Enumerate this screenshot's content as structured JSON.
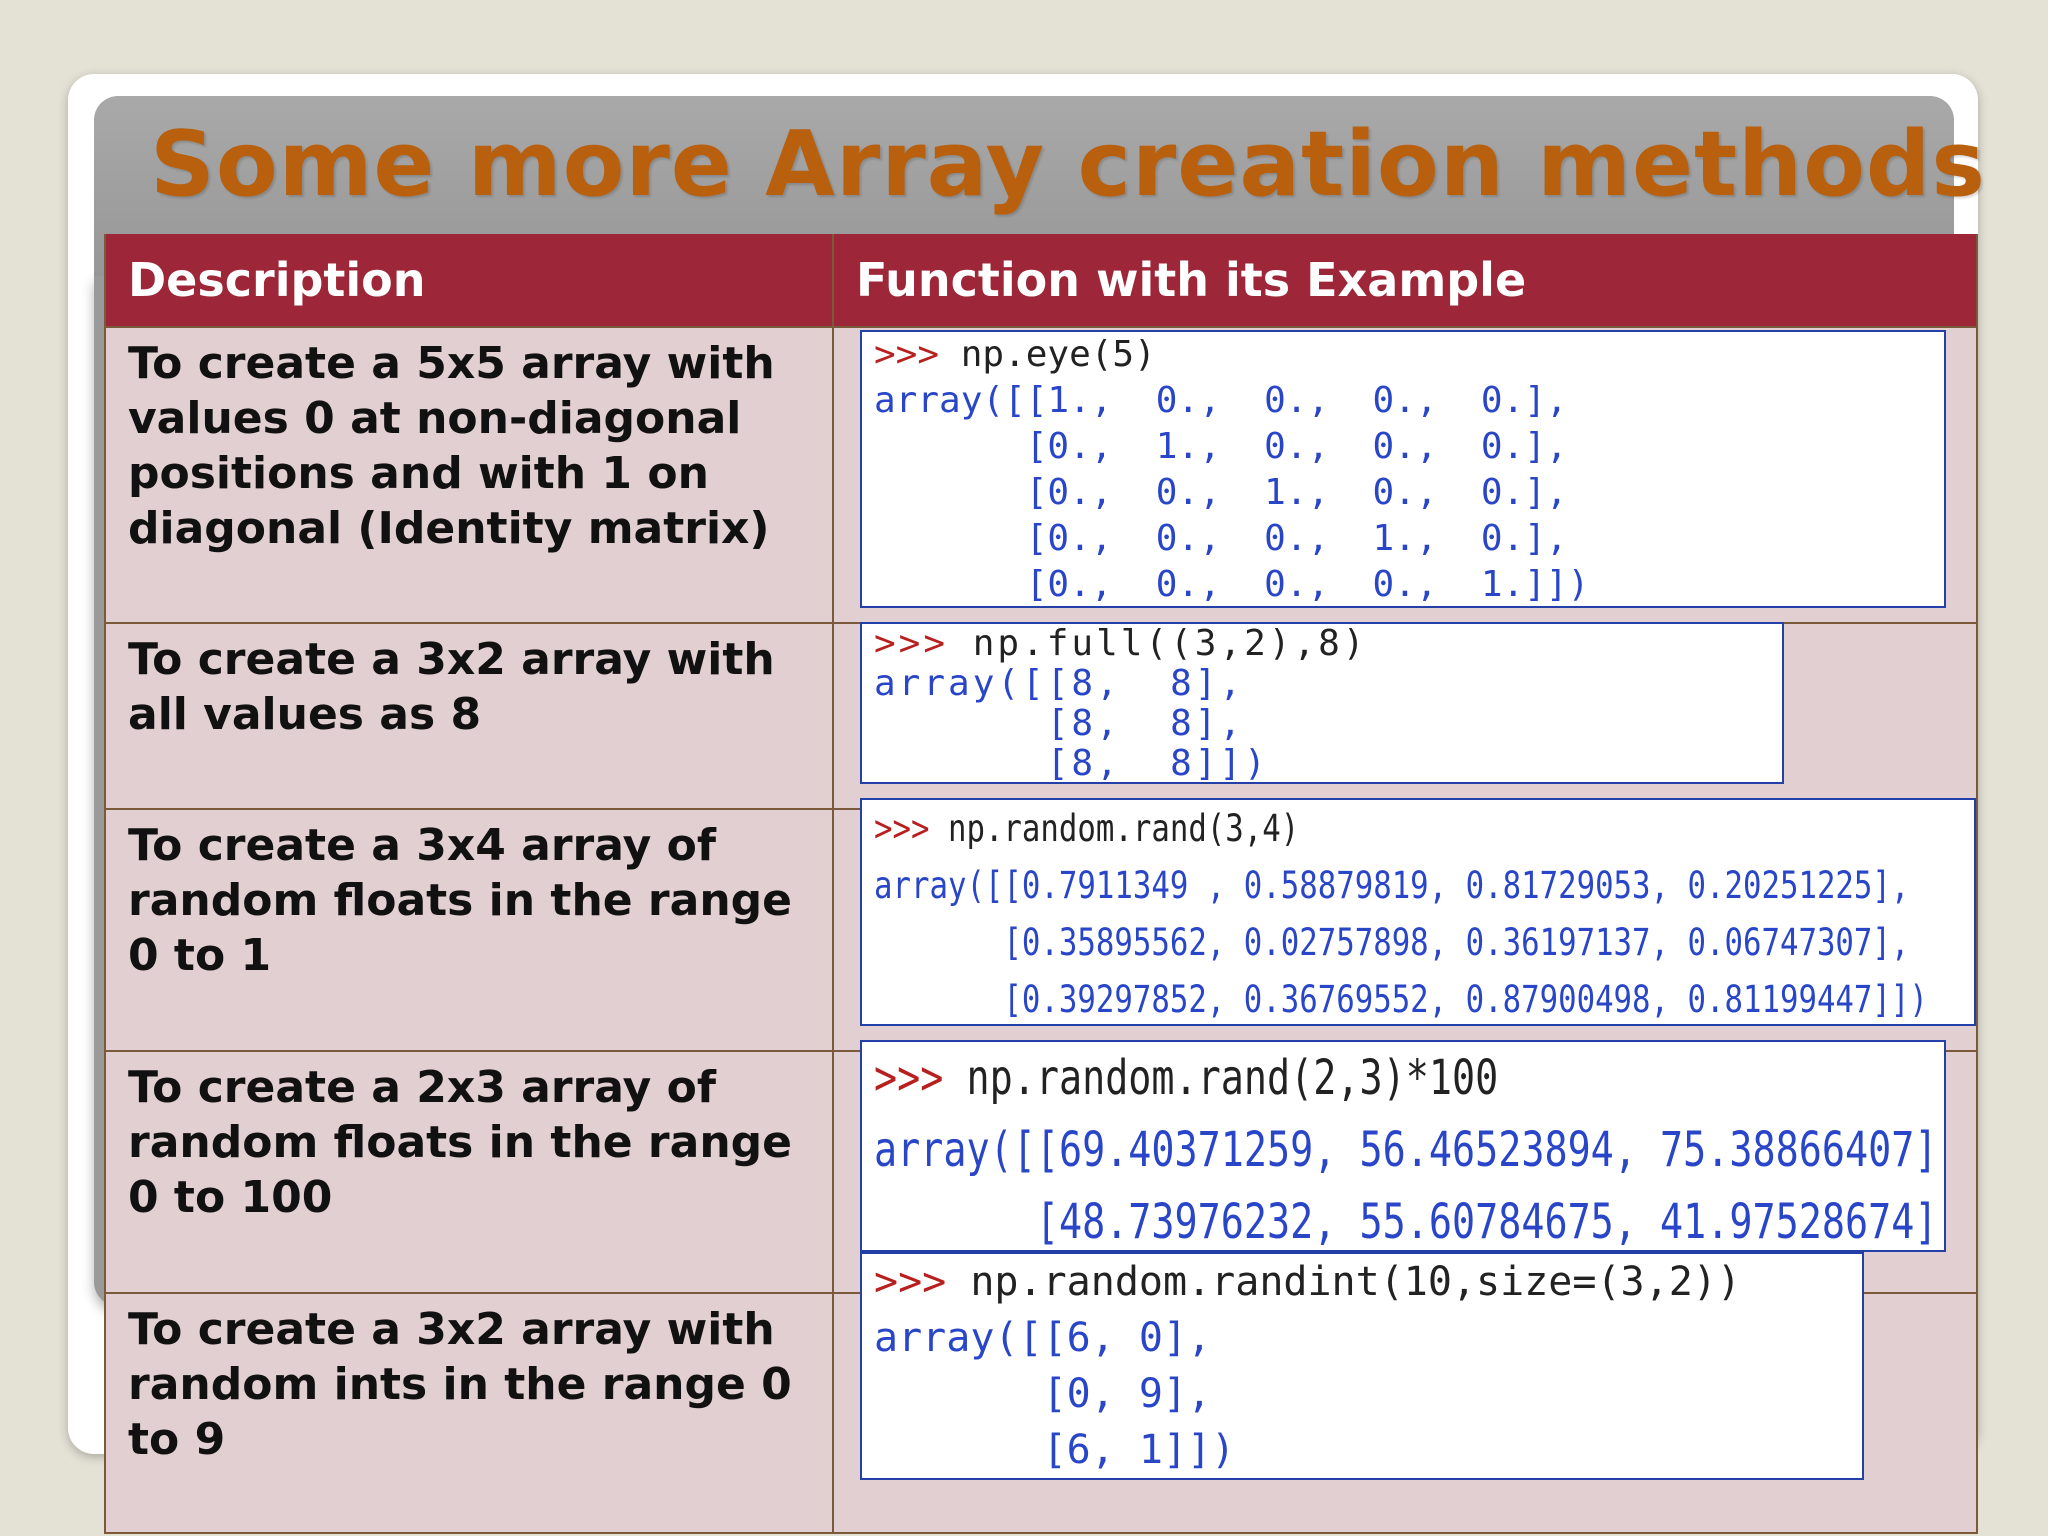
{
  "slide": {
    "title": "Some more Array creation methods"
  },
  "table": {
    "headers": [
      "Description",
      "Function with its Example"
    ],
    "rows": [
      {
        "description": "To create a 5x5 array with values 0 at non-diagonal positions and with 1 on diagonal (Identity matrix)",
        "prompt": ">>> ",
        "command": "np.eye(5)",
        "output": "array([[1.,  0.,  0.,  0.,  0.],\n       [0.,  1.,  0.,  0.,  0.],\n       [0.,  0.,  1.,  0.,  0.],\n       [0.,  0.,  0.,  1.,  0.],\n       [0.,  0.,  0.,  0.,  1.]])"
      },
      {
        "description": "To create a 3x2 array with all values as 8",
        "prompt": ">>> ",
        "command": "np.full((3,2),8)",
        "output": "array([[8,  8],\n       [8,  8],\n       [8,  8]])"
      },
      {
        "description": "To create a 3x4 array of random floats in the range 0 to 1",
        "prompt": ">>> ",
        "command": "np.random.rand(3,4)",
        "output": "array([[0.7911349 , 0.58879819, 0.81729053, 0.20251225],\n       [0.35895562, 0.02757898, 0.36197137, 0.06747307],\n       [0.39297852, 0.36769552, 0.87900498, 0.81199447]])"
      },
      {
        "description": "To create a 2x3 array of random floats in the range 0 to 100",
        "prompt": ">>> ",
        "command": "np.random.rand(2,3)*100",
        "output": "array([[69.40371259, 56.46523894, 75.38866407],\n       [48.73976232, 55.60784675, 41.97528674]])"
      },
      {
        "description": "To create a 3x2 array with random ints in the range 0 to 9",
        "prompt": ">>> ",
        "command": "np.random.randint(10,size=(3,2))",
        "output": "array([[6, 0],\n       [0, 9],\n       [6, 1]])"
      }
    ]
  }
}
